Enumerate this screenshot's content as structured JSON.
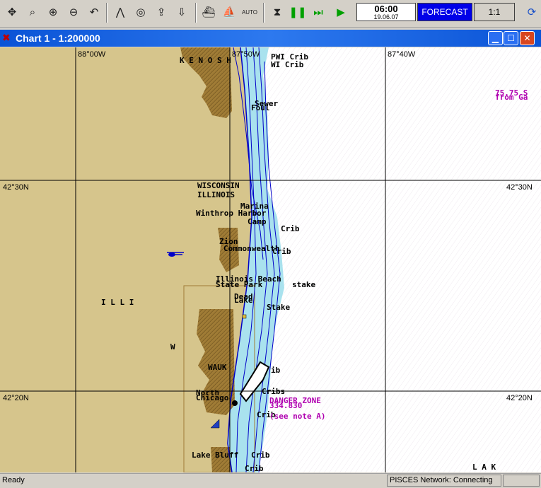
{
  "toolbar": {
    "buttons": [
      {
        "name": "move-icon",
        "glyph": "✥"
      },
      {
        "name": "zoom-window-icon",
        "glyph": "⌕"
      },
      {
        "name": "zoom-in-icon",
        "glyph": "⊕"
      },
      {
        "name": "zoom-out-icon",
        "glyph": "⊖"
      },
      {
        "name": "undo-icon",
        "glyph": "↶"
      },
      {
        "name": "compass-icon",
        "glyph": "⋀"
      },
      {
        "name": "target-icon",
        "glyph": "◎"
      },
      {
        "name": "export-icon",
        "glyph": "⇪"
      },
      {
        "name": "import-icon",
        "glyph": "⇩"
      },
      {
        "name": "ship-icon",
        "glyph": "⛴"
      },
      {
        "name": "vessel-icon",
        "glyph": "⛵"
      },
      {
        "name": "auto-icon",
        "glyph": "AUTO"
      },
      {
        "name": "stop-icon",
        "glyph": "⧗"
      },
      {
        "name": "pause-icon",
        "glyph": "❚❚"
      },
      {
        "name": "fast-forward-icon",
        "glyph": "⏭"
      },
      {
        "name": "play-icon",
        "glyph": "▶"
      }
    ],
    "time": "06:00",
    "date": "19.06.07",
    "forecast_label": "FORECAST",
    "scale_label": "1:1"
  },
  "window": {
    "title": "Chart 1 - 1:200000"
  },
  "chart": {
    "longitudes": [
      "88°00W",
      "87°50W",
      "87°40W"
    ],
    "latitudes": [
      "42°30N",
      "42°20N"
    ],
    "labels": {
      "kenosha": "K E N O S H",
      "pwi_crib": "PWI Crib",
      "wi_crib": "WI Crib",
      "sewer": "Sewer",
      "foul": "Foul",
      "wisconsin": "WISCONSIN",
      "illinois": "ILLINOIS",
      "marina": "Marina",
      "winthrop": "Winthrop Harbor",
      "camp": "Camp",
      "crib1": "Crib",
      "zion": "Zion",
      "commonwealth": "Commonwealth",
      "crib2": "Crib",
      "illinois_beach": "Illinois Beach",
      "state_park": "State Park",
      "stake1": "stake",
      "dead": "Dead",
      "lake": "Lake",
      "stake2": "Stake",
      "illi": "I L L I",
      "w": "W",
      "wauk": "WAUK",
      "ib": "ib",
      "north_chicago": "North",
      "chicago": "Chicago",
      "cribs": "Cribs",
      "danger_zone": "DANGER ZONE",
      "danger_num": "334.830",
      "crib3": "Crib",
      "see_note": "(see note A)",
      "lake_bluff": "Lake Bluff",
      "crib4": "Crib",
      "crib5": "Crib",
      "lak": "L A K",
      "mag1": "75.75 S",
      "mag2": "from Ga"
    }
  },
  "status": {
    "left": "Ready",
    "network": "PISCES Network: Connecting",
    "extra": ""
  },
  "colors": {
    "land": "#d6c58c",
    "shallow": "#a9e2ee",
    "water": "#ffffff",
    "urban": "#a07c36",
    "depth_line": "#0000c8"
  }
}
